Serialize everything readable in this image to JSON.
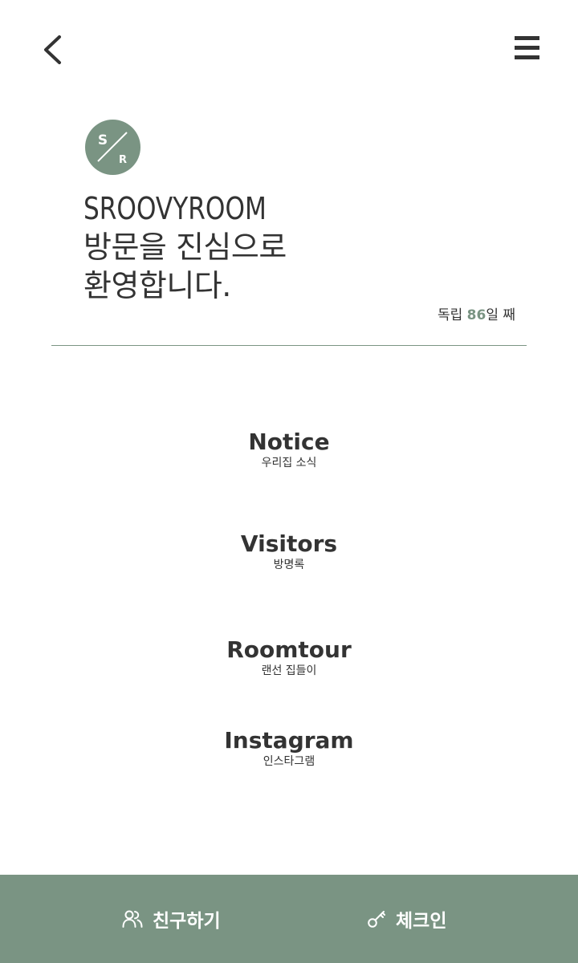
{
  "header": {
    "back_icon": "chevron-left-icon",
    "menu_icon": "hamburger-menu-icon"
  },
  "logo": {
    "top_letter": "S",
    "bottom_letter": "R",
    "color": "#7a9483"
  },
  "welcome": {
    "line1": "SROOVYROOM",
    "line2": "방문을 진심으로",
    "line3": "환영합니다."
  },
  "independence": {
    "prefix": "독립 ",
    "days": "86",
    "suffix": "일 째"
  },
  "menu": [
    {
      "title": "Notice",
      "subtitle": "우리집 소식"
    },
    {
      "title": "Visitors",
      "subtitle": "방명록"
    },
    {
      "title": "Roomtour",
      "subtitle": "랜선 집들이"
    },
    {
      "title": "Instagram",
      "subtitle": "인스타그램"
    }
  ],
  "bottom_bar": {
    "friend_label": "친구하기",
    "friend_icon": "users-icon",
    "checkin_label": "체크인",
    "checkin_icon": "key-icon",
    "color": "#7a9483"
  },
  "colors": {
    "accent": "#7a9483",
    "text": "#333333",
    "background": "#ffffff"
  }
}
